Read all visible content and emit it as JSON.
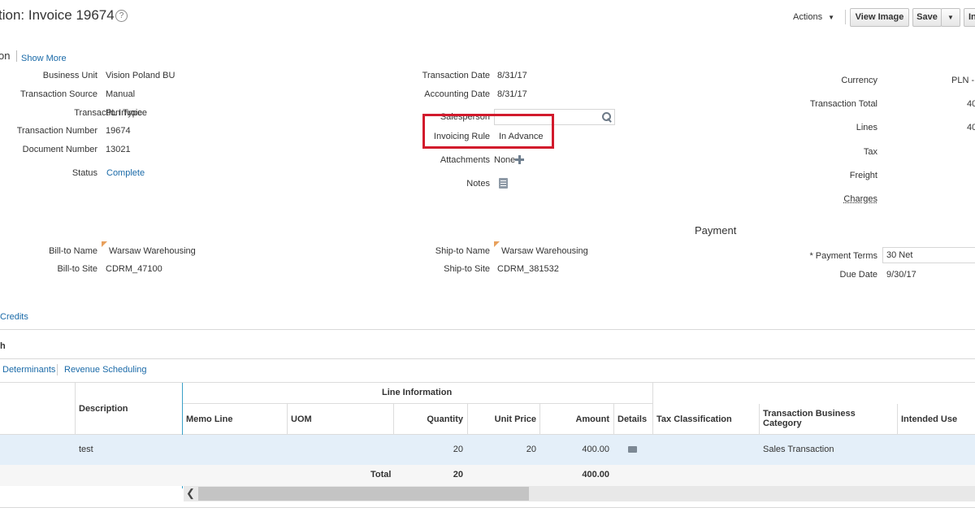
{
  "header": {
    "title": "tion: Invoice 19674",
    "help_glyph": "?",
    "actions_label": "Actions",
    "view_image_label": "View Image",
    "save_label": "Save",
    "partial_button_label": "In"
  },
  "section": {
    "title": "on",
    "show_more": "Show More"
  },
  "left_fields": {
    "business_unit_label": "Business Unit",
    "business_unit_value": "Vision Poland BU",
    "transaction_source_label": "Transaction Source",
    "transaction_source_value": "Manual",
    "transaction_type_label": "Transaction Type",
    "transaction_type_value": "PL Invoice",
    "transaction_number_label": "Transaction Number",
    "transaction_number_value": "19674",
    "document_number_label": "Document Number",
    "document_number_value": "13021",
    "status_label": "Status",
    "status_value": "Complete"
  },
  "middle_fields": {
    "transaction_date_label": "Transaction Date",
    "transaction_date_value": "8/31/17",
    "accounting_date_label": "Accounting Date",
    "accounting_date_value": "8/31/17",
    "salesperson_label": "Salesperson",
    "salesperson_value": "",
    "invoicing_rule_label": "Invoicing Rule",
    "invoicing_rule_value": "In Advance",
    "attachments_label": "Attachments",
    "attachments_value": "None",
    "notes_label": "Notes"
  },
  "right_fields": {
    "currency_label": "Currency",
    "currency_value": "PLN - ",
    "transaction_total_label": "Transaction Total",
    "transaction_total_value": "40",
    "lines_label": "Lines",
    "lines_value": "40",
    "tax_label": "Tax",
    "freight_label": "Freight",
    "charges_label": "Charges"
  },
  "billing": {
    "bill_to_name_label": "Bill-to Name",
    "bill_to_name_value": "Warsaw Warehousing",
    "bill_to_site_label": "Bill-to Site",
    "bill_to_site_value": "CDRM_47100",
    "ship_to_name_label": "Ship-to Name",
    "ship_to_name_value": "Warsaw Warehousing",
    "ship_to_site_label": "Ship-to Site",
    "ship_to_site_value": "CDRM_381532"
  },
  "payment": {
    "heading": "Payment",
    "terms_label": "* Payment Terms",
    "terms_value": "30 Net",
    "due_date_label": "Due Date",
    "due_date_value": "9/30/17"
  },
  "links": {
    "credits": "Credits",
    "partial_section": "h",
    "determinants": "Determinants",
    "revenue_scheduling": "Revenue Scheduling"
  },
  "table": {
    "description_header": "Description",
    "group_header": "Line Information",
    "columns": {
      "memo_line": "Memo Line",
      "uom": "UOM",
      "quantity": "Quantity",
      "unit_price": "Unit Price",
      "amount": "Amount",
      "details": "Details",
      "tax_classification": "Tax Classification",
      "business_category": "Transaction Business Category",
      "intended_use": "Intended Use"
    },
    "row": {
      "description": "test",
      "quantity": "20",
      "unit_price": "20",
      "amount": "400.00",
      "business_category": "Sales Transaction"
    },
    "total": {
      "label": "Total",
      "quantity": "20",
      "amount": "400.00"
    }
  },
  "colors": {
    "link": "#1a6aa8",
    "highlight_box": "#d21a2c",
    "selected_row": "#e4eff9"
  }
}
